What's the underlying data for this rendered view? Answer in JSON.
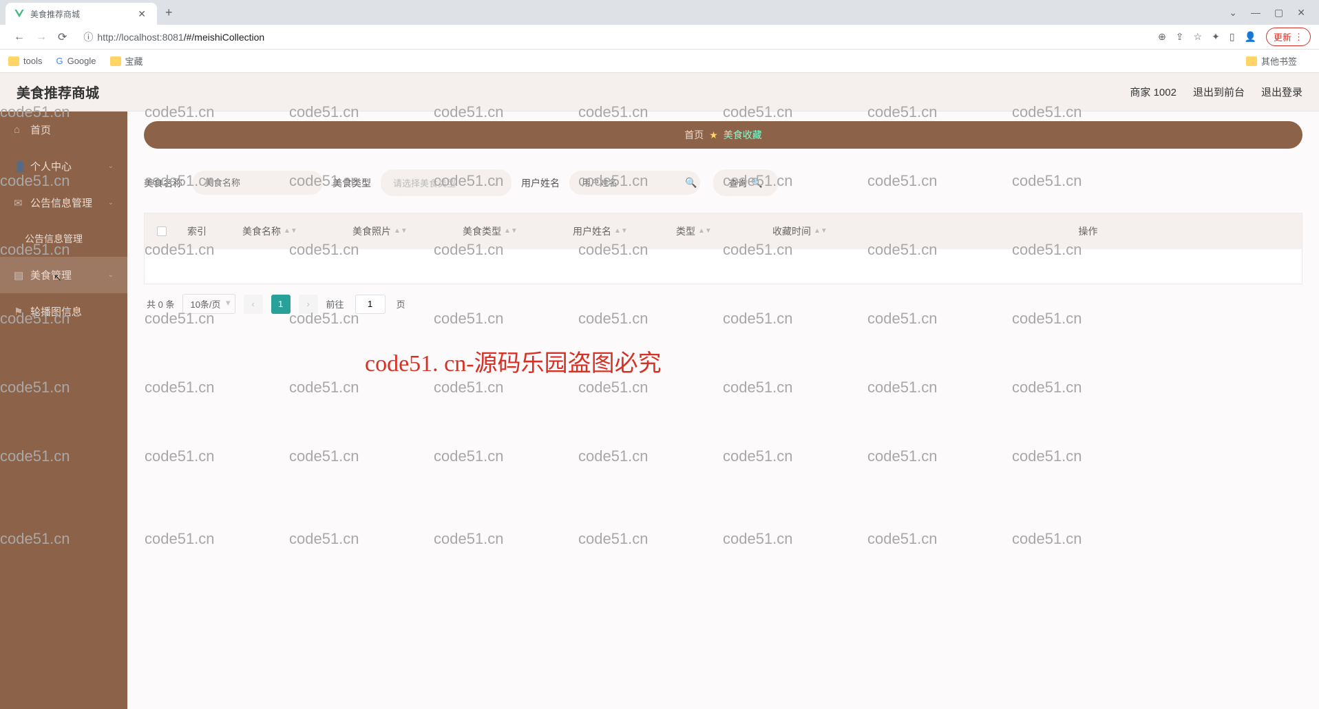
{
  "browser": {
    "tab_title": "美食推荐商城",
    "url_scheme_host": "http://localhost:8081",
    "url_path": "/#/meishiCollection",
    "update_label": "更新",
    "bookmarks": {
      "tools": "tools",
      "google": "Google",
      "baozang": "宝藏",
      "other": "其他书签"
    }
  },
  "header": {
    "title": "美食推荐商城",
    "merchant": "商家 1002",
    "logout_front": "退出到前台",
    "logout": "退出登录"
  },
  "sidebar": {
    "home": "首页",
    "personal": "个人中心",
    "notice": "公告信息管理",
    "notice_sub": "公告信息管理",
    "food": "美食管理",
    "carousel": "轮播图信息"
  },
  "breadcrumb": {
    "home": "首页",
    "current": "美食收藏"
  },
  "filters": {
    "name_label": "美食名称",
    "name_placeholder": "美食名称",
    "type_label": "美食类型",
    "type_placeholder": "请选择美食类型",
    "user_label": "用户姓名",
    "user_placeholder": "用户姓名",
    "query_label": "查询"
  },
  "table": {
    "cols": {
      "index": "索引",
      "name": "美食名称",
      "photo": "美食照片",
      "type": "美食类型",
      "user": "用户姓名",
      "kind": "类型",
      "time": "收藏时间",
      "ops": "操作"
    }
  },
  "pagination": {
    "total": "共 0 条",
    "page_size": "10条/页",
    "goto_prefix": "前往",
    "goto_value": "1",
    "goto_suffix": "页",
    "current_page": "1"
  },
  "watermark_text": "code51.cn",
  "overlay_text": "code51. cn-源码乐园盗图必究"
}
